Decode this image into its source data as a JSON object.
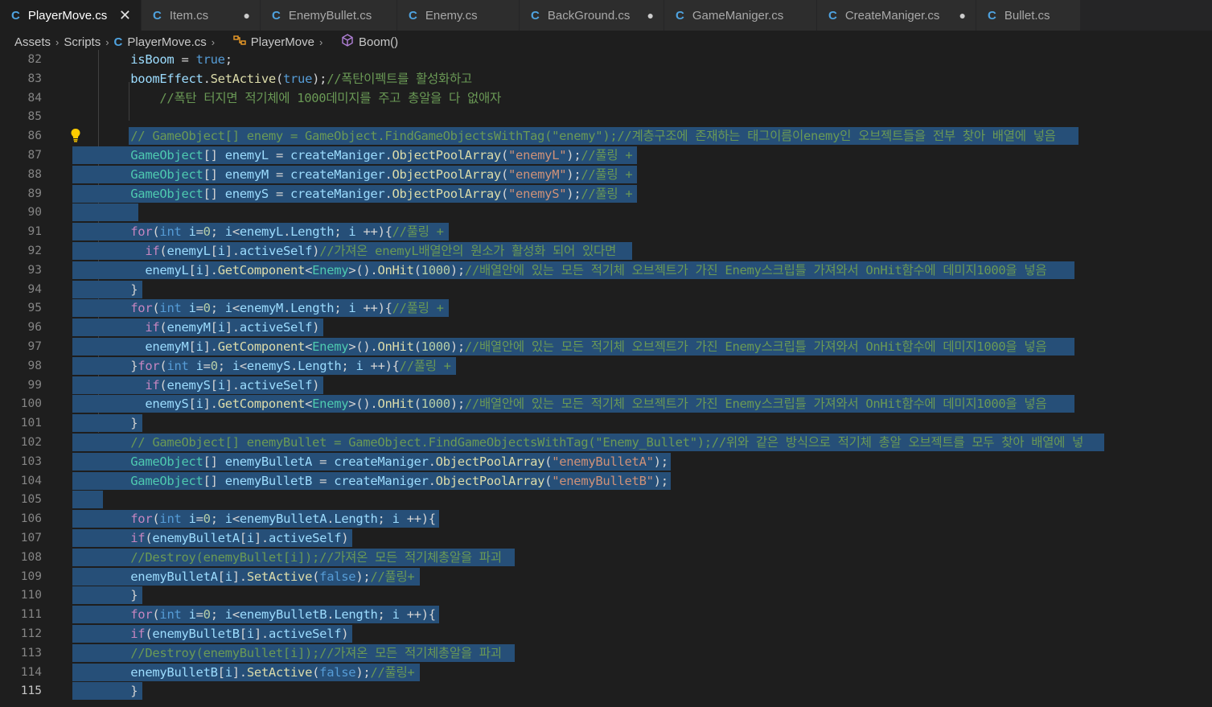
{
  "tabs": [
    {
      "label": "PlayerMove.cs",
      "active": true,
      "state": "close"
    },
    {
      "label": "Item.cs",
      "state": "dirty"
    },
    {
      "label": "EnemyBullet.cs",
      "state": ""
    },
    {
      "label": "Enemy.cs",
      "state": ""
    },
    {
      "label": "BackGround.cs",
      "state": "dirty"
    },
    {
      "label": "GameManiger.cs",
      "state": ""
    },
    {
      "label": "CreateManiger.cs",
      "state": "dirty"
    },
    {
      "label": "Bullet.cs",
      "state": ""
    }
  ],
  "breadcrumb": [
    "Assets",
    "Scripts",
    "PlayerMove.cs",
    "PlayerMove",
    "Boom()"
  ],
  "glyphs": {
    "close": "✕",
    "dirty": "●",
    "sep": "›",
    "cs": "C",
    "bulb": "💡"
  },
  "current_line": 115,
  "lines": [
    {
      "n": 82,
      "sel": false,
      "tokens": [
        [
          "p",
          "        "
        ],
        [
          "v",
          "isBoom"
        ],
        [
          "p",
          " = "
        ],
        [
          "k",
          "true"
        ],
        [
          "p",
          ";"
        ]
      ]
    },
    {
      "n": 83,
      "sel": false,
      "tokens": [
        [
          "p",
          "        "
        ],
        [
          "v",
          "boomEffect"
        ],
        [
          "p",
          "."
        ],
        [
          "f",
          "SetActive"
        ],
        [
          "p",
          "("
        ],
        [
          "k",
          "true"
        ],
        [
          "p",
          ");"
        ],
        [
          "c",
          "//폭탄이펙트를 활성화하고"
        ]
      ]
    },
    {
      "n": 84,
      "sel": false,
      "tokens": [
        [
          "p",
          "            "
        ],
        [
          "c",
          "//폭탄 터지면 적기체에 1000데미지를 주고 총알을 다 없애자"
        ]
      ]
    },
    {
      "n": 85,
      "sel": false,
      "tokens": []
    },
    {
      "n": 86,
      "sel": true,
      "tokens": [
        [
          "p",
          "        "
        ],
        [
          "c",
          "// GameObject[] enemy = GameObject.FindGameObjectsWithTag(\"enemy\");//계층구조에 존재하는 태그이름이enemy인 오브젝트들을 전부 찾아 배열에 넣음"
        ]
      ]
    },
    {
      "n": 87,
      "sel": true,
      "tokens": [
        [
          "p",
          "        "
        ],
        [
          "ty",
          "GameObject"
        ],
        [
          "p",
          "[] "
        ],
        [
          "v",
          "enemyL"
        ],
        [
          "p",
          " = "
        ],
        [
          "v",
          "createManiger"
        ],
        [
          "p",
          "."
        ],
        [
          "f",
          "ObjectPoolArray"
        ],
        [
          "p",
          "("
        ],
        [
          "s",
          "\"enemyL\""
        ],
        [
          "p",
          ");"
        ],
        [
          "c",
          "//풀링 +"
        ]
      ]
    },
    {
      "n": 88,
      "sel": true,
      "tokens": [
        [
          "p",
          "        "
        ],
        [
          "ty",
          "GameObject"
        ],
        [
          "p",
          "[] "
        ],
        [
          "v",
          "enemyM"
        ],
        [
          "p",
          " = "
        ],
        [
          "v",
          "createManiger"
        ],
        [
          "p",
          "."
        ],
        [
          "f",
          "ObjectPoolArray"
        ],
        [
          "p",
          "("
        ],
        [
          "s",
          "\"enemyM\""
        ],
        [
          "p",
          ");"
        ],
        [
          "c",
          "//풀링 +"
        ]
      ]
    },
    {
      "n": 89,
      "sel": true,
      "tokens": [
        [
          "p",
          "        "
        ],
        [
          "ty",
          "GameObject"
        ],
        [
          "p",
          "[] "
        ],
        [
          "v",
          "enemyS"
        ],
        [
          "p",
          " = "
        ],
        [
          "v",
          "createManiger"
        ],
        [
          "p",
          "."
        ],
        [
          "f",
          "ObjectPoolArray"
        ],
        [
          "p",
          "("
        ],
        [
          "s",
          "\"enemyS\""
        ],
        [
          "p",
          ");"
        ],
        [
          "c",
          "//풀링 +"
        ]
      ]
    },
    {
      "n": 90,
      "sel": true,
      "tokens": [
        [
          "p",
          "        "
        ]
      ]
    },
    {
      "n": 91,
      "sel": true,
      "tokens": [
        [
          "p",
          "        "
        ],
        [
          "ctrl",
          "for"
        ],
        [
          "p",
          "("
        ],
        [
          "k",
          "int"
        ],
        [
          "p",
          " "
        ],
        [
          "v",
          "i"
        ],
        [
          "p",
          "="
        ],
        [
          "n",
          "0"
        ],
        [
          "p",
          "; "
        ],
        [
          "v",
          "i"
        ],
        [
          "p",
          "<"
        ],
        [
          "v",
          "enemyL"
        ],
        [
          "p",
          "."
        ],
        [
          "v",
          "Length"
        ],
        [
          "p",
          "; "
        ],
        [
          "v",
          "i"
        ],
        [
          "p",
          " ++){"
        ],
        [
          "c",
          "//풀링 +"
        ]
      ]
    },
    {
      "n": 92,
      "sel": true,
      "tokens": [
        [
          "p",
          "          "
        ],
        [
          "ctrl",
          "if"
        ],
        [
          "p",
          "("
        ],
        [
          "v",
          "enemyL"
        ],
        [
          "p",
          "["
        ],
        [
          "v",
          "i"
        ],
        [
          "p",
          "]."
        ],
        [
          "v",
          "activeSelf"
        ],
        [
          "p",
          ")"
        ],
        [
          "c",
          "//가져온 enemyL배열안의 원소가 활성화 되어 있다면"
        ]
      ]
    },
    {
      "n": 93,
      "sel": true,
      "tokens": [
        [
          "p",
          "          "
        ],
        [
          "v",
          "enemyL"
        ],
        [
          "p",
          "["
        ],
        [
          "v",
          "i"
        ],
        [
          "p",
          "]."
        ],
        [
          "f",
          "GetComponent"
        ],
        [
          "p",
          "<"
        ],
        [
          "ty",
          "Enemy"
        ],
        [
          "p",
          ">()."
        ],
        [
          "f",
          "OnHit"
        ],
        [
          "p",
          "("
        ],
        [
          "n",
          "1000"
        ],
        [
          "p",
          ");"
        ],
        [
          "c",
          "//배열안에 있는 모든 적기체 오브젝트가 가진 Enemy스크립틀 가져와서 OnHit함수에 데미지1000을 넣음"
        ]
      ]
    },
    {
      "n": 94,
      "sel": true,
      "tokens": [
        [
          "p",
          "        }"
        ]
      ]
    },
    {
      "n": 95,
      "sel": true,
      "tokens": [
        [
          "p",
          "        "
        ],
        [
          "ctrl",
          "for"
        ],
        [
          "p",
          "("
        ],
        [
          "k",
          "int"
        ],
        [
          "p",
          " "
        ],
        [
          "v",
          "i"
        ],
        [
          "p",
          "="
        ],
        [
          "n",
          "0"
        ],
        [
          "p",
          "; "
        ],
        [
          "v",
          "i"
        ],
        [
          "p",
          "<"
        ],
        [
          "v",
          "enemyM"
        ],
        [
          "p",
          "."
        ],
        [
          "v",
          "Length"
        ],
        [
          "p",
          "; "
        ],
        [
          "v",
          "i"
        ],
        [
          "p",
          " ++){"
        ],
        [
          "c",
          "//풀링 +"
        ]
      ]
    },
    {
      "n": 96,
      "sel": true,
      "tokens": [
        [
          "p",
          "          "
        ],
        [
          "ctrl",
          "if"
        ],
        [
          "p",
          "("
        ],
        [
          "v",
          "enemyM"
        ],
        [
          "p",
          "["
        ],
        [
          "v",
          "i"
        ],
        [
          "p",
          "]."
        ],
        [
          "v",
          "activeSelf"
        ],
        [
          "p",
          ")"
        ]
      ]
    },
    {
      "n": 97,
      "sel": true,
      "tokens": [
        [
          "p",
          "          "
        ],
        [
          "v",
          "enemyM"
        ],
        [
          "p",
          "["
        ],
        [
          "v",
          "i"
        ],
        [
          "p",
          "]."
        ],
        [
          "f",
          "GetComponent"
        ],
        [
          "p",
          "<"
        ],
        [
          "ty",
          "Enemy"
        ],
        [
          "p",
          ">()."
        ],
        [
          "f",
          "OnHit"
        ],
        [
          "p",
          "("
        ],
        [
          "n",
          "1000"
        ],
        [
          "p",
          ");"
        ],
        [
          "c",
          "//배열안에 있는 모든 적기체 오브젝트가 가진 Enemy스크립틀 가져와서 OnHit함수에 데미지1000을 넣음"
        ]
      ]
    },
    {
      "n": 98,
      "sel": true,
      "tokens": [
        [
          "p",
          "        }"
        ],
        [
          "ctrl",
          "for"
        ],
        [
          "p",
          "("
        ],
        [
          "k",
          "int"
        ],
        [
          "p",
          " "
        ],
        [
          "v",
          "i"
        ],
        [
          "p",
          "="
        ],
        [
          "n",
          "0"
        ],
        [
          "p",
          "; "
        ],
        [
          "v",
          "i"
        ],
        [
          "p",
          "<"
        ],
        [
          "v",
          "enemyS"
        ],
        [
          "p",
          "."
        ],
        [
          "v",
          "Length"
        ],
        [
          "p",
          "; "
        ],
        [
          "v",
          "i"
        ],
        [
          "p",
          " ++){"
        ],
        [
          "c",
          "//풀링 +"
        ]
      ]
    },
    {
      "n": 99,
      "sel": true,
      "tokens": [
        [
          "p",
          "          "
        ],
        [
          "ctrl",
          "if"
        ],
        [
          "p",
          "("
        ],
        [
          "v",
          "enemyS"
        ],
        [
          "p",
          "["
        ],
        [
          "v",
          "i"
        ],
        [
          "p",
          "]."
        ],
        [
          "v",
          "activeSelf"
        ],
        [
          "p",
          ")"
        ]
      ]
    },
    {
      "n": 100,
      "sel": true,
      "tokens": [
        [
          "p",
          "          "
        ],
        [
          "v",
          "enemyS"
        ],
        [
          "p",
          "["
        ],
        [
          "v",
          "i"
        ],
        [
          "p",
          "]."
        ],
        [
          "f",
          "GetComponent"
        ],
        [
          "p",
          "<"
        ],
        [
          "ty",
          "Enemy"
        ],
        [
          "p",
          ">()."
        ],
        [
          "f",
          "OnHit"
        ],
        [
          "p",
          "("
        ],
        [
          "n",
          "1000"
        ],
        [
          "p",
          ");"
        ],
        [
          "c",
          "//배열안에 있는 모든 적기체 오브젝트가 가진 Enemy스크립틀 가져와서 OnHit함수에 데미지1000을 넣음"
        ]
      ]
    },
    {
      "n": 101,
      "sel": true,
      "tokens": [
        [
          "p",
          "        }"
        ]
      ]
    },
    {
      "n": 102,
      "sel": true,
      "tokens": [
        [
          "p",
          "        "
        ],
        [
          "c",
          "// GameObject[] enemyBullet = GameObject.FindGameObjectsWithTag(\"Enemy_Bullet\");//위와 같은 방식으로 적기체 총알 오브젝트를 모두 찾아 배열에 넣"
        ]
      ]
    },
    {
      "n": 103,
      "sel": true,
      "tokens": [
        [
          "p",
          "        "
        ],
        [
          "ty",
          "GameObject"
        ],
        [
          "p",
          "[] "
        ],
        [
          "v",
          "enemyBulletA"
        ],
        [
          "p",
          " = "
        ],
        [
          "v",
          "createManiger"
        ],
        [
          "p",
          "."
        ],
        [
          "f",
          "ObjectPoolArray"
        ],
        [
          "p",
          "("
        ],
        [
          "s",
          "\"enemyBulletA\""
        ],
        [
          "p",
          ");"
        ]
      ]
    },
    {
      "n": 104,
      "sel": true,
      "tokens": [
        [
          "p",
          "        "
        ],
        [
          "ty",
          "GameObject"
        ],
        [
          "p",
          "[] "
        ],
        [
          "v",
          "enemyBulletB"
        ],
        [
          "p",
          " = "
        ],
        [
          "v",
          "createManiger"
        ],
        [
          "p",
          "."
        ],
        [
          "f",
          "ObjectPoolArray"
        ],
        [
          "p",
          "("
        ],
        [
          "s",
          "\"enemyBulletB\""
        ],
        [
          "p",
          ");"
        ]
      ]
    },
    {
      "n": 105,
      "sel": true,
      "tokens": [
        [
          "p",
          "  "
        ]
      ]
    },
    {
      "n": 106,
      "sel": true,
      "tokens": [
        [
          "p",
          "        "
        ],
        [
          "ctrl",
          "for"
        ],
        [
          "p",
          "("
        ],
        [
          "k",
          "int"
        ],
        [
          "p",
          " "
        ],
        [
          "v",
          "i"
        ],
        [
          "p",
          "="
        ],
        [
          "n",
          "0"
        ],
        [
          "p",
          "; "
        ],
        [
          "v",
          "i"
        ],
        [
          "p",
          "<"
        ],
        [
          "v",
          "enemyBulletA"
        ],
        [
          "p",
          "."
        ],
        [
          "v",
          "Length"
        ],
        [
          "p",
          "; "
        ],
        [
          "v",
          "i"
        ],
        [
          "p",
          " ++){"
        ]
      ]
    },
    {
      "n": 107,
      "sel": true,
      "tokens": [
        [
          "p",
          "        "
        ],
        [
          "ctrl",
          "if"
        ],
        [
          "p",
          "("
        ],
        [
          "v",
          "enemyBulletA"
        ],
        [
          "p",
          "["
        ],
        [
          "v",
          "i"
        ],
        [
          "p",
          "]."
        ],
        [
          "v",
          "activeSelf"
        ],
        [
          "p",
          ")"
        ]
      ]
    },
    {
      "n": 108,
      "sel": true,
      "tokens": [
        [
          "p",
          "        "
        ],
        [
          "c",
          "//Destroy(enemyBullet[i]);//가져온 모든 적기체총알을 파괴"
        ]
      ]
    },
    {
      "n": 109,
      "sel": true,
      "tokens": [
        [
          "p",
          "        "
        ],
        [
          "v",
          "enemyBulletA"
        ],
        [
          "p",
          "["
        ],
        [
          "v",
          "i"
        ],
        [
          "p",
          "]."
        ],
        [
          "f",
          "SetActive"
        ],
        [
          "p",
          "("
        ],
        [
          "k",
          "false"
        ],
        [
          "p",
          ");"
        ],
        [
          "c",
          "//풀링+"
        ]
      ]
    },
    {
      "n": 110,
      "sel": true,
      "tokens": [
        [
          "p",
          "        }"
        ]
      ]
    },
    {
      "n": 111,
      "sel": true,
      "tokens": [
        [
          "p",
          "        "
        ],
        [
          "ctrl",
          "for"
        ],
        [
          "p",
          "("
        ],
        [
          "k",
          "int"
        ],
        [
          "p",
          " "
        ],
        [
          "v",
          "i"
        ],
        [
          "p",
          "="
        ],
        [
          "n",
          "0"
        ],
        [
          "p",
          "; "
        ],
        [
          "v",
          "i"
        ],
        [
          "p",
          "<"
        ],
        [
          "v",
          "enemyBulletB"
        ],
        [
          "p",
          "."
        ],
        [
          "v",
          "Length"
        ],
        [
          "p",
          "; "
        ],
        [
          "v",
          "i"
        ],
        [
          "p",
          " ++){"
        ]
      ]
    },
    {
      "n": 112,
      "sel": true,
      "tokens": [
        [
          "p",
          "        "
        ],
        [
          "ctrl",
          "if"
        ],
        [
          "p",
          "("
        ],
        [
          "v",
          "enemyBulletB"
        ],
        [
          "p",
          "["
        ],
        [
          "v",
          "i"
        ],
        [
          "p",
          "]."
        ],
        [
          "v",
          "activeSelf"
        ],
        [
          "p",
          ")"
        ]
      ]
    },
    {
      "n": 113,
      "sel": true,
      "tokens": [
        [
          "p",
          "        "
        ],
        [
          "c",
          "//Destroy(enemyBullet[i]);//가져온 모든 적기체총알을 파괴"
        ]
      ]
    },
    {
      "n": 114,
      "sel": true,
      "tokens": [
        [
          "p",
          "        "
        ],
        [
          "v",
          "enemyBulletB"
        ],
        [
          "p",
          "["
        ],
        [
          "v",
          "i"
        ],
        [
          "p",
          "]."
        ],
        [
          "f",
          "SetActive"
        ],
        [
          "p",
          "("
        ],
        [
          "k",
          "false"
        ],
        [
          "p",
          ");"
        ],
        [
          "c",
          "//풀링+"
        ]
      ]
    },
    {
      "n": 115,
      "sel": true,
      "tokens": [
        [
          "p",
          "        }"
        ]
      ]
    }
  ]
}
